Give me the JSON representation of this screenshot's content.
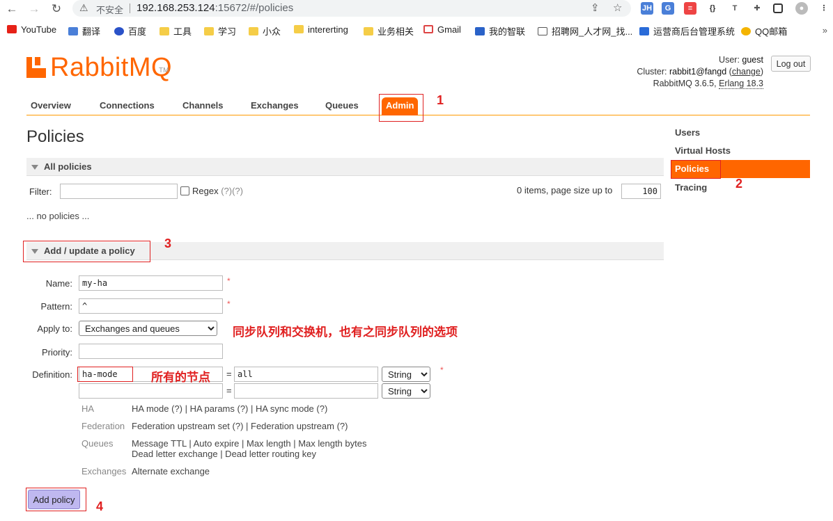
{
  "browser": {
    "insecure_label": "不安全",
    "url_host": "192.168.253.124",
    "url_path": ":15672/#/policies",
    "bookmarks": [
      "YouTube",
      "翻译",
      "百度",
      "工具",
      "学习",
      "小众",
      "intererting",
      "业务相关",
      "Gmail",
      "我的智联",
      "招聘网_人才网_找...",
      "运营商后台管理系统",
      "QQ邮箱"
    ]
  },
  "header": {
    "logo_text": "RabbitMQ",
    "logo_tm": "TM",
    "user_label": "User:",
    "user_value": "guest",
    "cluster_label": "Cluster:",
    "cluster_value": "rabbit1@fangd",
    "change_link": "change",
    "version_text": "RabbitMQ 3.6.5,",
    "erlang_text": "Erlang 18.3",
    "logout_label": "Log out"
  },
  "tabs": [
    "Overview",
    "Connections",
    "Channels",
    "Exchanges",
    "Queues",
    "Admin"
  ],
  "page_title": "Policies",
  "sidebar": [
    "Users",
    "Virtual Hosts",
    "Policies",
    "Tracing"
  ],
  "all_policies": {
    "title": "All policies",
    "filter_label": "Filter:",
    "regex_label": "Regex",
    "regex_help": "(?)(?)",
    "items_label": "0 items, page size up to",
    "page_size": "100",
    "empty_text": "... no policies ..."
  },
  "add_policy": {
    "title": "Add / update a policy",
    "name_label": "Name:",
    "name_value": "my-ha",
    "pattern_label": "Pattern:",
    "pattern_value": "^",
    "apply_label": "Apply to:",
    "apply_value": "Exchanges and queues",
    "priority_label": "Priority:",
    "priority_value": "",
    "definition_label": "Definition:",
    "def_key": "ha-mode",
    "def_value": "all",
    "def_type": "String",
    "def_type2": "String",
    "required_mark": "*",
    "eq": "=",
    "hints": [
      {
        "category": "HA",
        "links": "HA mode (?) | HA params (?) | HA sync mode (?)"
      },
      {
        "category": "Federation",
        "links": "Federation upstream set (?) | Federation upstream (?)"
      },
      {
        "category": "Queues",
        "links": "Message TTL | Auto expire | Max length | Max length bytes",
        "links2": "Dead letter exchange | Dead letter routing key"
      },
      {
        "category": "Exchanges",
        "links": "Alternate exchange"
      }
    ],
    "submit_label": "Add policy"
  },
  "annotations": {
    "n1": "1",
    "n2": "2",
    "n3": "3",
    "n4": "4",
    "apply_note": "同步队列和交换机，也有之同步队列的选项",
    "def_note": "所有的节点"
  }
}
